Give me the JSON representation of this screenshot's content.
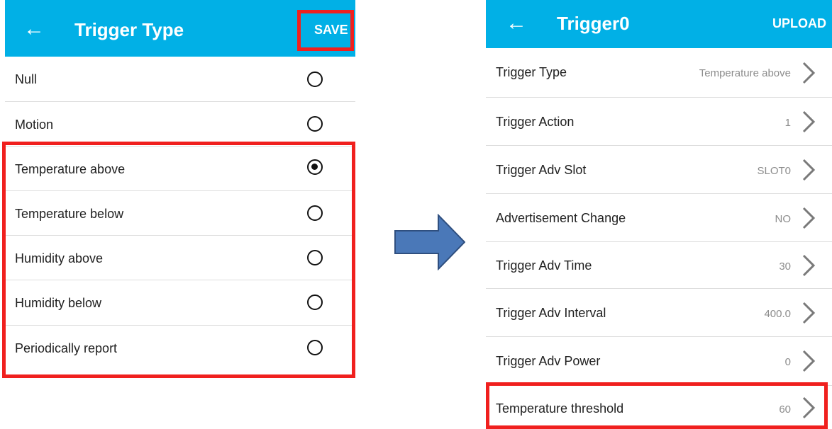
{
  "left": {
    "back_icon": "←",
    "title": "Trigger Type",
    "save_label": "SAVE",
    "options": [
      {
        "label": "Null",
        "selected": false
      },
      {
        "label": "Motion",
        "selected": false
      },
      {
        "label": "Temperature above",
        "selected": true
      },
      {
        "label": "Temperature below",
        "selected": false
      },
      {
        "label": "Humidity above",
        "selected": false
      },
      {
        "label": "Humidity below",
        "selected": false
      },
      {
        "label": "Periodically report",
        "selected": false
      }
    ]
  },
  "right": {
    "back_icon": "←",
    "title": "Trigger0",
    "upload_label": "UPLOAD",
    "rows": [
      {
        "label": "Trigger Type",
        "value": "Temperature above"
      },
      {
        "label": "Trigger Action",
        "value": "1"
      },
      {
        "label": "Trigger Adv Slot",
        "value": "SLOT0"
      },
      {
        "label": "Advertisement Change",
        "value": "NO"
      },
      {
        "label": "Trigger Adv Time",
        "value": "30"
      },
      {
        "label": "Trigger Adv Interval",
        "value": "400.0"
      },
      {
        "label": "Trigger Adv Power",
        "value": "0"
      },
      {
        "label": "Temperature threshold",
        "value": "60"
      }
    ]
  },
  "colors": {
    "appbar": "#01b0e6",
    "highlight": "#f0201e",
    "arrow_fill": "#4a78b8",
    "arrow_stroke": "#2f4f7f"
  },
  "icons": {
    "back": "arrow-left-icon",
    "chevron": "chevron-right-icon",
    "flow_arrow": "right-arrow-icon"
  }
}
